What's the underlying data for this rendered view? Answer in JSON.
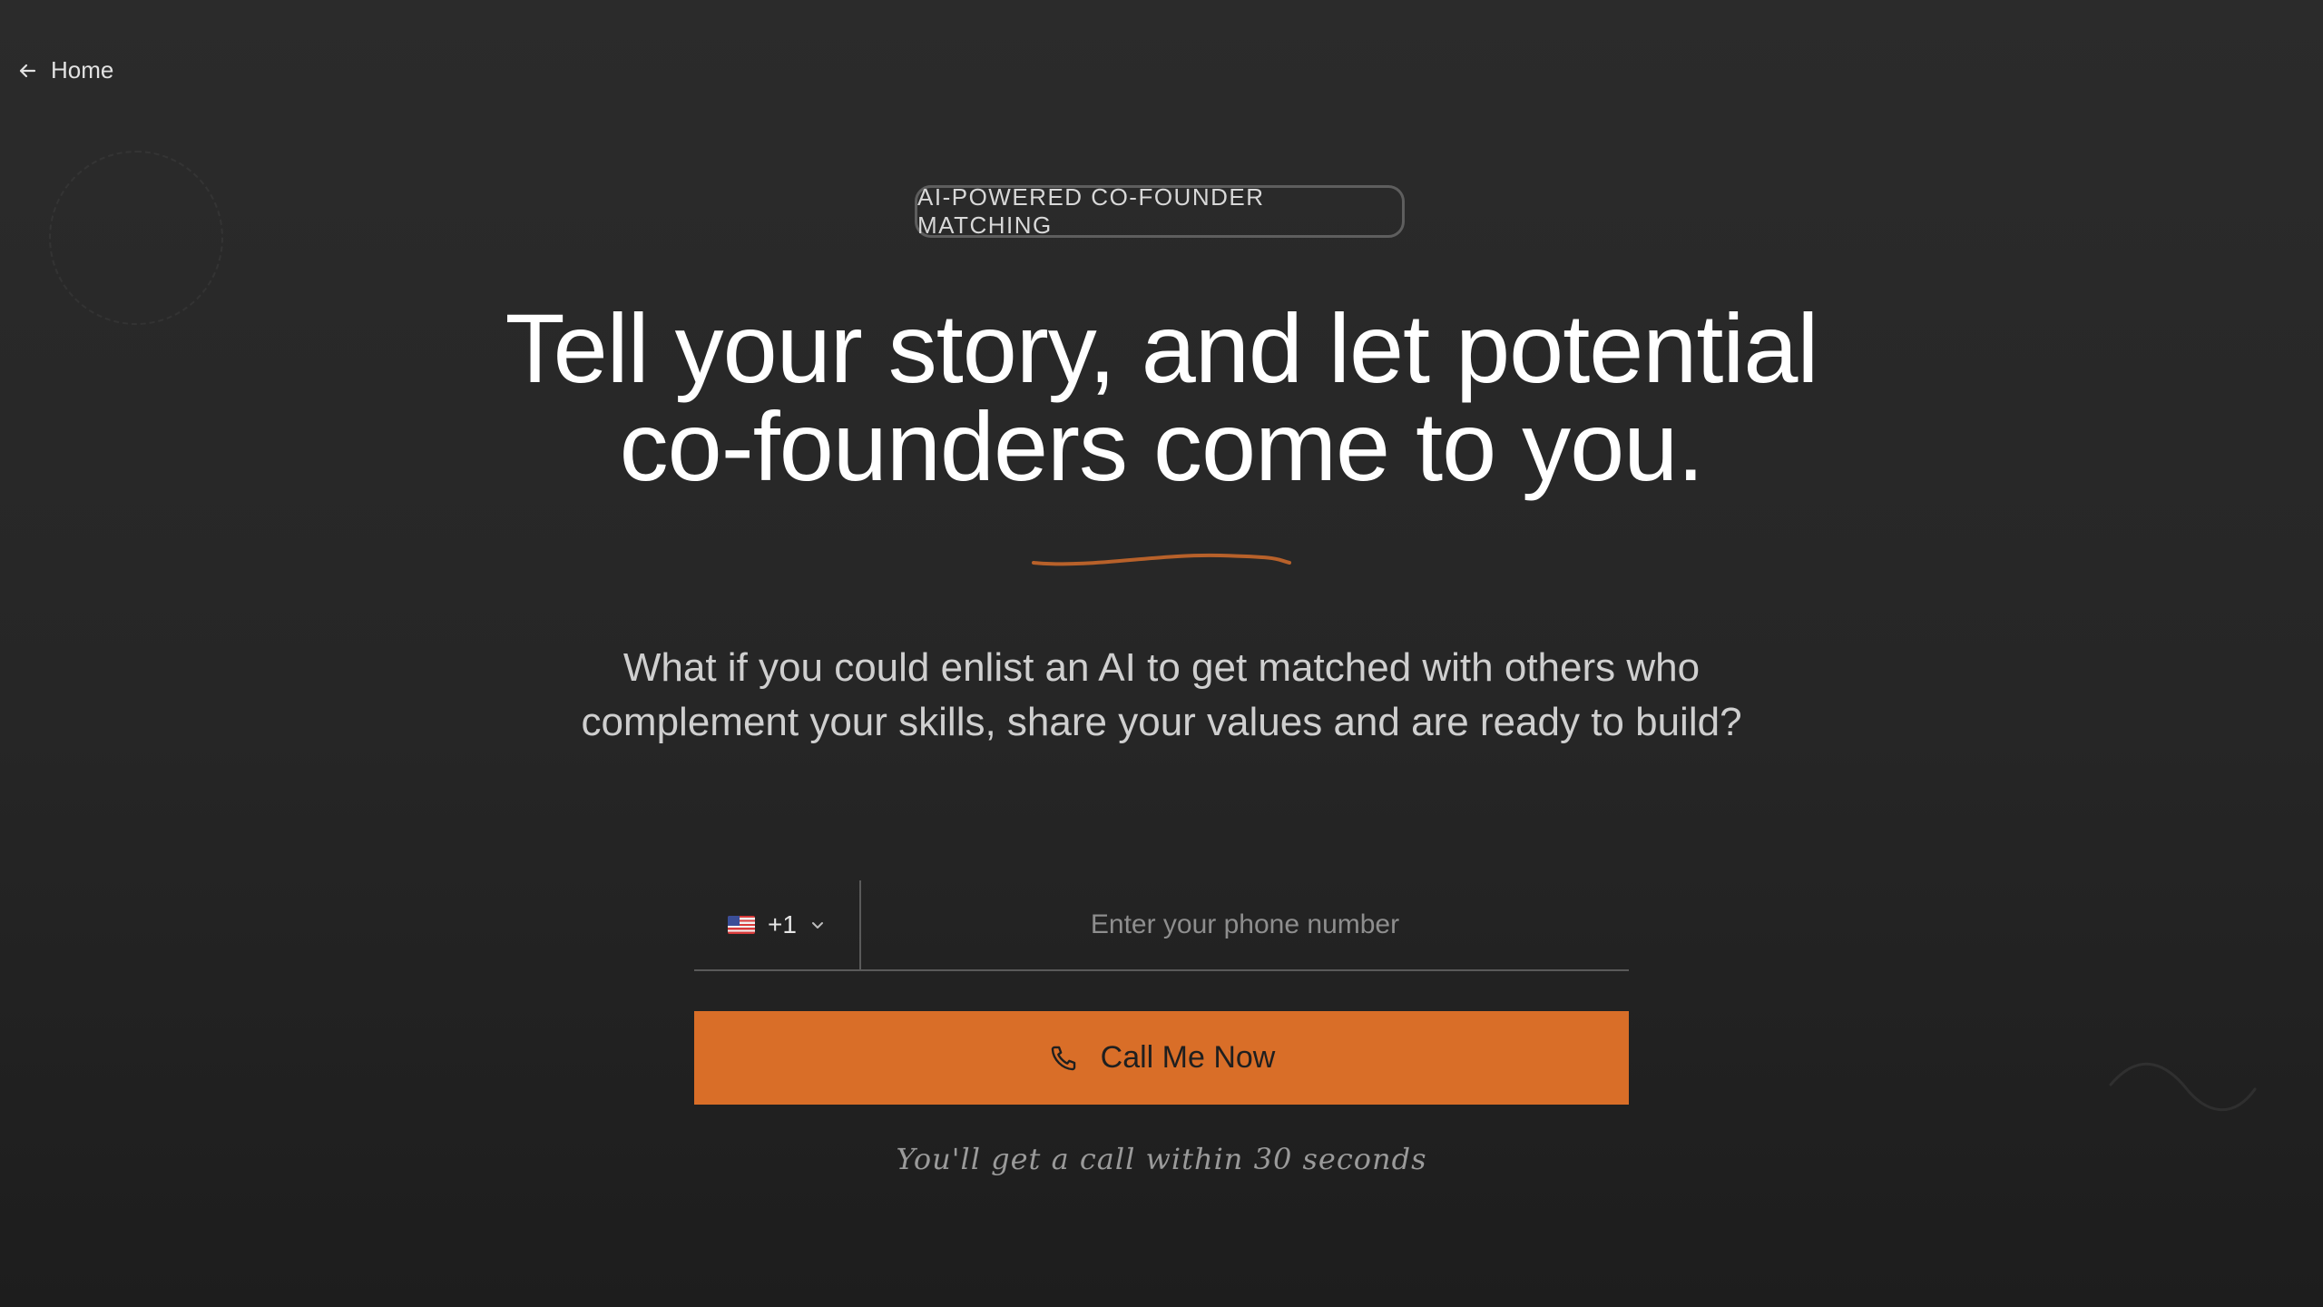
{
  "nav": {
    "home_label": "Home"
  },
  "badge": {
    "text": "AI-POWERED CO-FOUNDER MATCHING"
  },
  "hero": {
    "headline_line1": "Tell your story, and let potential",
    "headline_line2": "co-founders come to you.",
    "subtitle_line1": "What if you could enlist an AI to get matched with others who",
    "subtitle_line2": "complement your skills, share your values and are ready to build?"
  },
  "phone_form": {
    "country_code": "+1",
    "country_flag": "us-flag-icon",
    "placeholder": "Enter your phone number",
    "value": ""
  },
  "cta": {
    "label": "Call Me Now",
    "icon": "phone-icon",
    "note": "You'll get a call within 30 seconds"
  },
  "colors": {
    "accent": "#d96e28",
    "background": "#272727",
    "text": "#ffffff",
    "muted_text": "#cfcfcf"
  }
}
